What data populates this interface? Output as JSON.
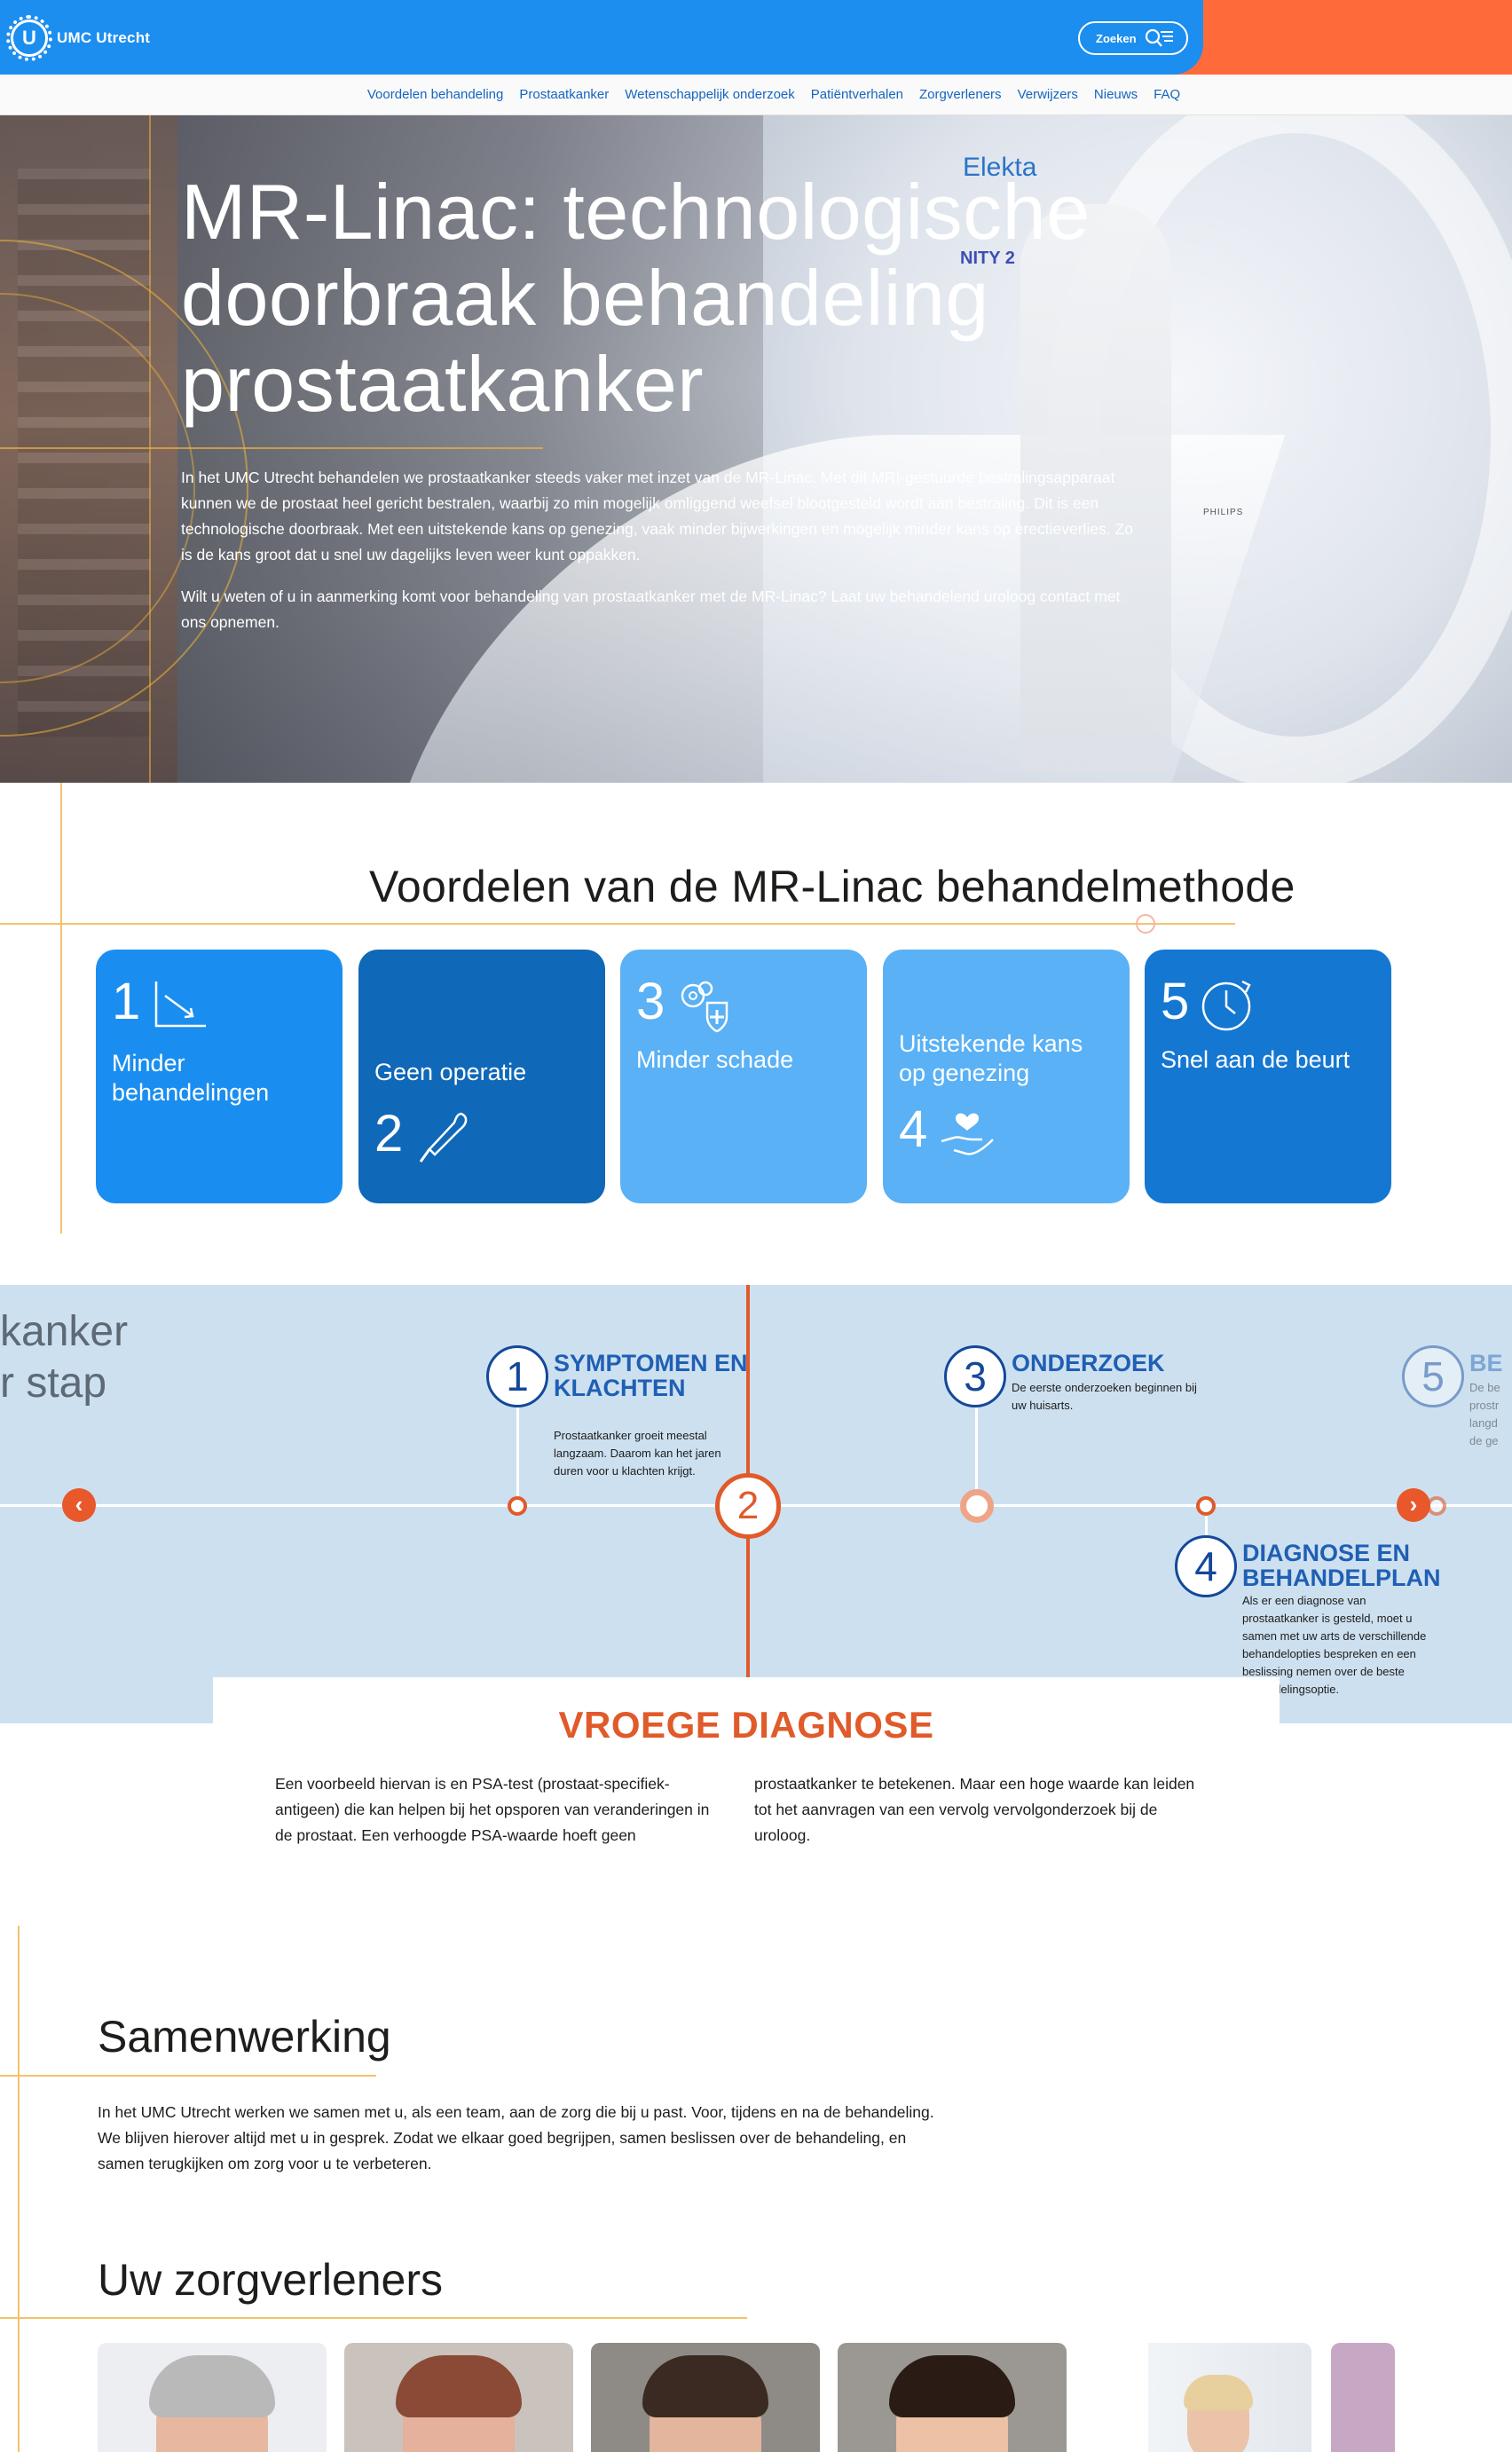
{
  "header": {
    "logo_text": "UMC Utrecht",
    "logo_letter": "U",
    "search_label": "Zoeken",
    "colors": {
      "brand_blue": "#1b8ef0",
      "accent_orange": "#ff6a3a"
    }
  },
  "subnav": {
    "items": [
      "Voordelen behandeling",
      "Prostaatkanker",
      "Wetenschappelijk onderzoek",
      "Patiëntverhalen",
      "Zorgverleners",
      "Verwijzers",
      "Nieuws",
      "FAQ"
    ]
  },
  "hero": {
    "title": "MR-Linac: technologische doorbraak behandeling prostaatkanker",
    "paragraph_1": "In het UMC Utrecht behandelen we prostaatkanker steeds vaker met inzet van de MR-Linac. Met dit MRI-gestuurde bestralingsapparaat kunnen we de prostaat heel gericht bestralen, waarbij zo min mogelijk omliggend weefsel blootgesteld wordt aan bestraling. Dit is een technologische doorbraak. Met een uitstekende kans op genezing, vaak minder bijwerkingen en mogelijk minder kans op erectieverlies. Zo is de kans groot dat u snel uw dagelijks leven weer kunt oppakken.",
    "paragraph_2": "Wilt u weten of u in aanmerking komt voor behandeling van prostaatkanker met de MR-Linac? Laat uw behandelend uroloog contact met ons opnemen.",
    "photo_text": {
      "elekta": "Elekta",
      "unity": "NITY 2",
      "philips": "PHILIPS"
    }
  },
  "voordelen": {
    "title": "Voordelen van de MR-Linac behandelmethode",
    "tiles": [
      {
        "number": "1",
        "label": "Minder behandelingen",
        "icon": "chart-down-icon"
      },
      {
        "number": "2",
        "label": "Geen operatie",
        "icon": "scalpel-icon"
      },
      {
        "number": "3",
        "label": "Minder schade",
        "icon": "cells-plus-icon"
      },
      {
        "number": "4",
        "label": "Uitstekende kans op genezing",
        "icon": "hand-heart-icon"
      },
      {
        "number": "5",
        "label": "Snel aan de beurt",
        "icon": "clock-icon"
      }
    ]
  },
  "timeline": {
    "partial_title_line1": "kanker",
    "partial_title_line2": "r stap",
    "active_step": "2",
    "prev_arrow": "‹",
    "next_arrow": "›",
    "steps": [
      {
        "number": "1",
        "title": "SYMPTOMEN EN KLACHTEN",
        "desc": "Prostaatkanker groeit meestal langzaam. Daarom kan het jaren duren voor u klachten krijgt."
      },
      {
        "number": "3",
        "title": "ONDERZOEK",
        "desc": "De eerste onderzoeken beginnen bij uw huisarts."
      },
      {
        "number": "4",
        "title": "DIAGNOSE EN BEHANDELPLAN",
        "desc": "Als er een diagnose van prostaatkanker is gesteld, moet u samen met uw arts de verschillende behandelopties bespreken en een beslissing nemen over de beste behandelingsoptie."
      },
      {
        "number": "5",
        "title": "BE",
        "desc": "De be prostr langd de ge"
      }
    ]
  },
  "diagnose": {
    "title": "VROEGE DIAGNOSE",
    "col_1": "Een voorbeeld hiervan is en PSA-test (prostaat-specifiek-antigeen) die kan helpen bij het opsporen van veranderingen in de prostaat. Een verhoogde PSA-waarde hoeft geen",
    "col_2": "prostaatkanker te betekenen. Maar een hoge waarde kan leiden tot het aanvragen van een vervolg vervolgonderzoek bij de uroloog."
  },
  "samenwerking": {
    "title": "Samenwerking",
    "text": "In het UMC Utrecht werken we samen met u, als een team, aan de zorg die bij u past. Voor, tijdens en na de behandeling. We blijven hierover altijd met u in gesprek. Zodat we elkaar goed begrijpen, samen beslissen over de behandeling, en samen terugkijken om zorg voor u te verbeteren."
  },
  "zorgverleners": {
    "title": "Uw zorgverleners"
  }
}
